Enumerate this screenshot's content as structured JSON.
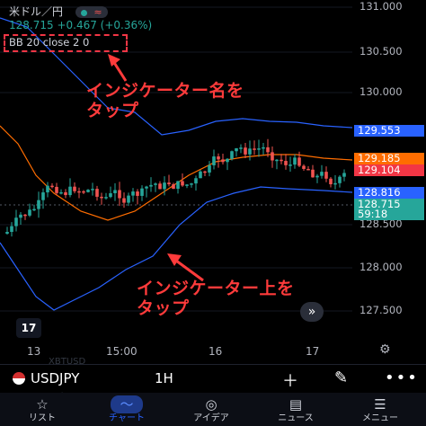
{
  "header": {
    "pair_label": "米ドル／円",
    "price_change": "128.715 +0.467 (+0.36%)",
    "indicator_label": "BB 20 close 2 0"
  },
  "annotations": {
    "top_line1": "インジケーター名を",
    "top_line2": "タップ",
    "bottom_line1": "インジケーター上を",
    "bottom_line2": "タップ"
  },
  "price_axis": {
    "ticks": [
      "131.000",
      "130.500",
      "130.000",
      "128.500",
      "128.000",
      "127.500"
    ],
    "tags": {
      "upper_band": "129.553",
      "ask": "129.185",
      "bid": "129.104",
      "lower_band": "128.816",
      "last_price": "128.715",
      "countdown": "59:18"
    }
  },
  "time_axis": {
    "labels": [
      "13",
      "15:00",
      "16",
      "17"
    ]
  },
  "logo_text": "17",
  "toolbar": {
    "symbol": "USDJPY",
    "timeframe": "1H",
    "add_icon": "plus-icon",
    "draw_icon": "pen-icon",
    "more_icon": "more-icon"
  },
  "ghost_text": {
    "row1": "XBTUSD",
    "row2": "NIクラス"
  },
  "nav": {
    "items": [
      {
        "label": "リスト",
        "icon": "star-icon"
      },
      {
        "label": "チャート",
        "icon": "chart-icon"
      },
      {
        "label": "アイデア",
        "icon": "bulb-icon"
      },
      {
        "label": "ニュース",
        "icon": "news-icon"
      },
      {
        "label": "メニュー",
        "icon": "menu-icon"
      }
    ]
  },
  "colors": {
    "up": "#26a69a",
    "down": "#ef5350",
    "band": "#2962ff",
    "basis": "#ff6d00",
    "annotation": "#ff3b3b"
  }
}
